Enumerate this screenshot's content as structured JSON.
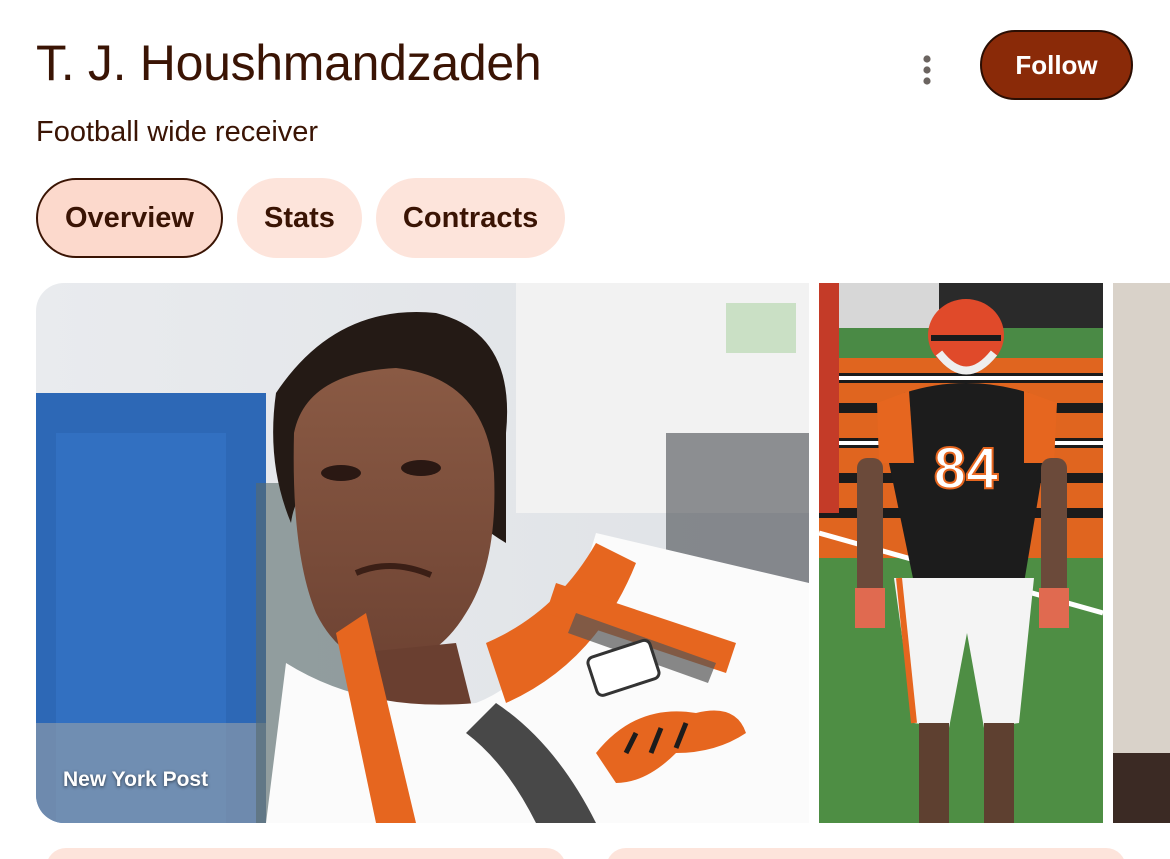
{
  "header": {
    "title": "T. J. Houshmandzadeh",
    "subtitle": "Football wide receiver",
    "follow_label": "Follow",
    "more_icon": "more-vertical-icon"
  },
  "tabs": [
    {
      "label": "Overview",
      "active": true
    },
    {
      "label": "Stats",
      "active": false
    },
    {
      "label": "Contracts",
      "active": false
    }
  ],
  "gallery": {
    "images": [
      {
        "source": "New York Post"
      },
      {
        "source": ""
      },
      {
        "source": ""
      }
    ]
  },
  "colors": {
    "accent": "#8a2a08",
    "text": "#3a1404",
    "chip_bg": "#fde4db"
  }
}
